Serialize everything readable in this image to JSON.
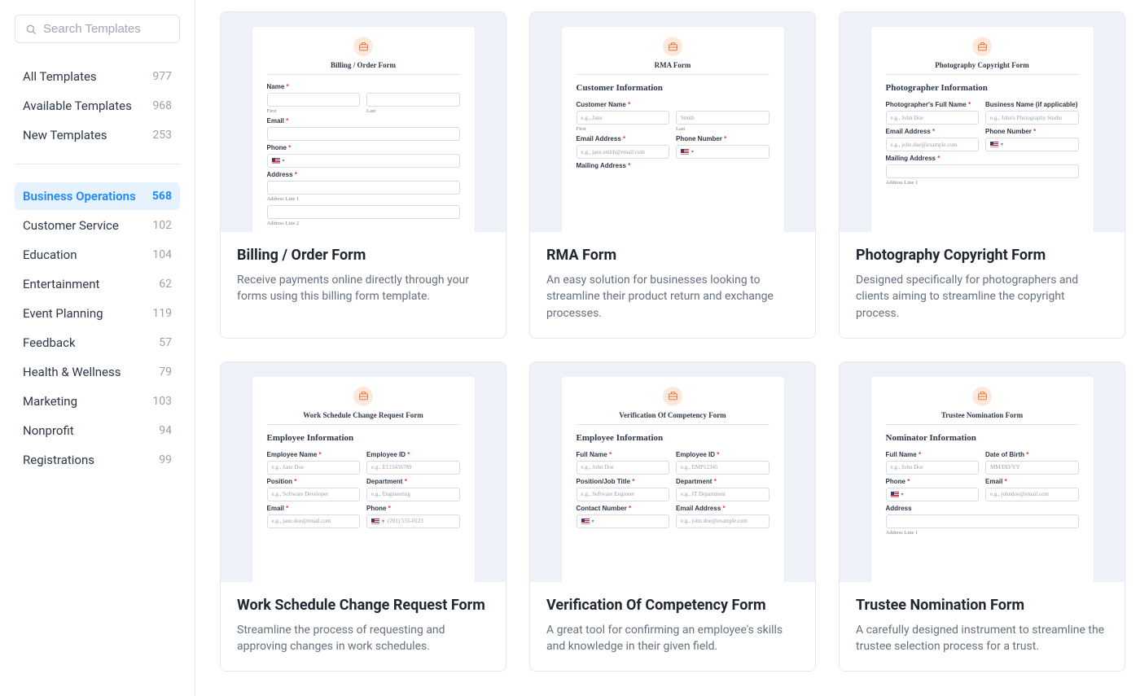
{
  "search": {
    "placeholder": "Search Templates"
  },
  "nav_primary": [
    {
      "label": "All Templates",
      "count": "977",
      "active": false
    },
    {
      "label": "Available Templates",
      "count": "968",
      "active": false
    },
    {
      "label": "New Templates",
      "count": "253",
      "active": false
    }
  ],
  "nav_categories": [
    {
      "label": "Business Operations",
      "count": "568",
      "active": true
    },
    {
      "label": "Customer Service",
      "count": "102",
      "active": false
    },
    {
      "label": "Education",
      "count": "104",
      "active": false
    },
    {
      "label": "Entertainment",
      "count": "62",
      "active": false
    },
    {
      "label": "Event Planning",
      "count": "119",
      "active": false
    },
    {
      "label": "Feedback",
      "count": "57",
      "active": false
    },
    {
      "label": "Health & Wellness",
      "count": "79",
      "active": false
    },
    {
      "label": "Marketing",
      "count": "103",
      "active": false
    },
    {
      "label": "Nonprofit",
      "count": "94",
      "active": false
    },
    {
      "label": "Registrations",
      "count": "99",
      "active": false
    }
  ],
  "cards": [
    {
      "title": "Billing / Order Form",
      "desc": "Receive payments online directly through your forms using this billing form template.",
      "preview": {
        "form_title": "Billing / Order Form",
        "section": "",
        "rows": [
          {
            "label": "Name",
            "req": true,
            "cols": [
              {
                "ph": "",
                "sub": "First"
              },
              {
                "ph": "",
                "sub": "Last"
              }
            ]
          },
          {
            "label": "Email",
            "req": true,
            "cols": [
              {
                "ph": ""
              }
            ]
          },
          {
            "label": "Phone",
            "req": true,
            "cols": [
              {
                "ph": "",
                "flag": true
              }
            ]
          },
          {
            "label": "Address",
            "req": true,
            "cols": [
              {
                "ph": "",
                "sub": "Address Line 1"
              }
            ]
          },
          {
            "label": "",
            "req": false,
            "cols": [
              {
                "ph": "",
                "sub": "Address Line 2"
              }
            ]
          }
        ]
      }
    },
    {
      "title": "RMA Form",
      "desc": "An easy solution for businesses looking to streamline their product return and exchange processes.",
      "preview": {
        "form_title": "RMA Form",
        "section": "Customer Information",
        "rows": [
          {
            "label": "Customer Name",
            "req": true,
            "cols": [
              {
                "ph": "e.g., Jane",
                "sub": "First"
              },
              {
                "ph": "Smith",
                "sub": "Last"
              }
            ]
          },
          {
            "label": "",
            "req": false,
            "cols": [
              {
                "label2": "Email Address",
                "req2": true,
                "ph": "e.g., jane.smith@email.com"
              },
              {
                "label2": "Phone Number",
                "req2": true,
                "ph": "",
                "flag": true
              }
            ]
          },
          {
            "label": "Mailing Address",
            "req": true,
            "cols": []
          }
        ]
      }
    },
    {
      "title": "Photography Copyright Form",
      "desc": "Designed specifically for photographers and clients aiming to streamline the copyright process.",
      "preview": {
        "form_title": "Photography Copyright Form",
        "section": "Photographer Information",
        "rows": [
          {
            "label": "",
            "req": false,
            "cols": [
              {
                "label2": "Photographer's Full Name",
                "req2": true,
                "ph": "e.g., John Doe"
              },
              {
                "label2": "Business Name (if applicable)",
                "req2": false,
                "ph": "e.g., John's Photography Studio"
              }
            ]
          },
          {
            "label": "",
            "req": false,
            "cols": [
              {
                "label2": "Email Address",
                "req2": true,
                "ph": "e.g., john.doe@example.com"
              },
              {
                "label2": "Phone Number",
                "req2": true,
                "ph": "",
                "flag": true
              }
            ]
          },
          {
            "label": "Mailing Address",
            "req": true,
            "cols": [
              {
                "ph": "",
                "sub": "Address Line 1"
              }
            ]
          }
        ]
      }
    },
    {
      "title": "Work Schedule Change Request Form",
      "desc": "Streamline the process of requesting and approving changes in work schedules.",
      "preview": {
        "form_title": "Work Schedule Change Request Form",
        "section": "Employee Information",
        "rows": [
          {
            "label": "",
            "req": false,
            "cols": [
              {
                "label2": "Employee Name",
                "req2": true,
                "ph": "e.g., Jane Doe"
              },
              {
                "label2": "Employee ID",
                "req2": true,
                "ph": "e.g., E123456789"
              }
            ]
          },
          {
            "label": "",
            "req": false,
            "cols": [
              {
                "label2": "Position",
                "req2": true,
                "ph": "e.g., Software Developer"
              },
              {
                "label2": "Department",
                "req2": true,
                "ph": "e.g., Engineering"
              }
            ]
          },
          {
            "label": "",
            "req": false,
            "cols": [
              {
                "label2": "Email",
                "req2": true,
                "ph": "e.g., jane.doe@email.com"
              },
              {
                "label2": "Phone",
                "req2": true,
                "ph": "(201) 555-0123",
                "flag": true
              }
            ]
          }
        ]
      }
    },
    {
      "title": "Verification Of Competency Form",
      "desc": "A great tool for confirming an employee's skills and knowledge in their given field.",
      "preview": {
        "form_title": "Verification Of Competency Form",
        "section": "Employee Information",
        "rows": [
          {
            "label": "",
            "req": false,
            "cols": [
              {
                "label2": "Full Name",
                "req2": true,
                "ph": "e.g., John Doe"
              },
              {
                "label2": "Employee ID",
                "req2": true,
                "ph": "e.g., EMP12345"
              }
            ]
          },
          {
            "label": "",
            "req": false,
            "cols": [
              {
                "label2": "Position/Job Title",
                "req2": true,
                "ph": "e.g., Software Engineer"
              },
              {
                "label2": "Department",
                "req2": true,
                "ph": "e.g., IT Department"
              }
            ]
          },
          {
            "label": "",
            "req": false,
            "cols": [
              {
                "label2": "Contact Number",
                "req2": true,
                "ph": "",
                "flag": true
              },
              {
                "label2": "Email Address",
                "req2": true,
                "ph": "e.g., john.doe@example.com"
              }
            ]
          }
        ]
      }
    },
    {
      "title": "Trustee Nomination Form",
      "desc": "A carefully designed instrument to streamline the trustee selection process for a trust.",
      "preview": {
        "form_title": "Trustee Nomination Form",
        "section": "Nominator Information",
        "rows": [
          {
            "label": "",
            "req": false,
            "cols": [
              {
                "label2": "Full Name",
                "req2": true,
                "ph": "e.g., John Doe"
              },
              {
                "label2": "Date of Birth",
                "req2": true,
                "ph": "MM/DD/YY"
              }
            ]
          },
          {
            "label": "",
            "req": false,
            "cols": [
              {
                "label2": "Phone",
                "req2": true,
                "ph": "",
                "flag": true
              },
              {
                "label2": "Email",
                "req2": true,
                "ph": "e.g., johndoe@email.com"
              }
            ]
          },
          {
            "label": "Address",
            "req": false,
            "cols": [
              {
                "ph": "",
                "sub": "Address Line 1"
              }
            ]
          }
        ]
      }
    }
  ]
}
